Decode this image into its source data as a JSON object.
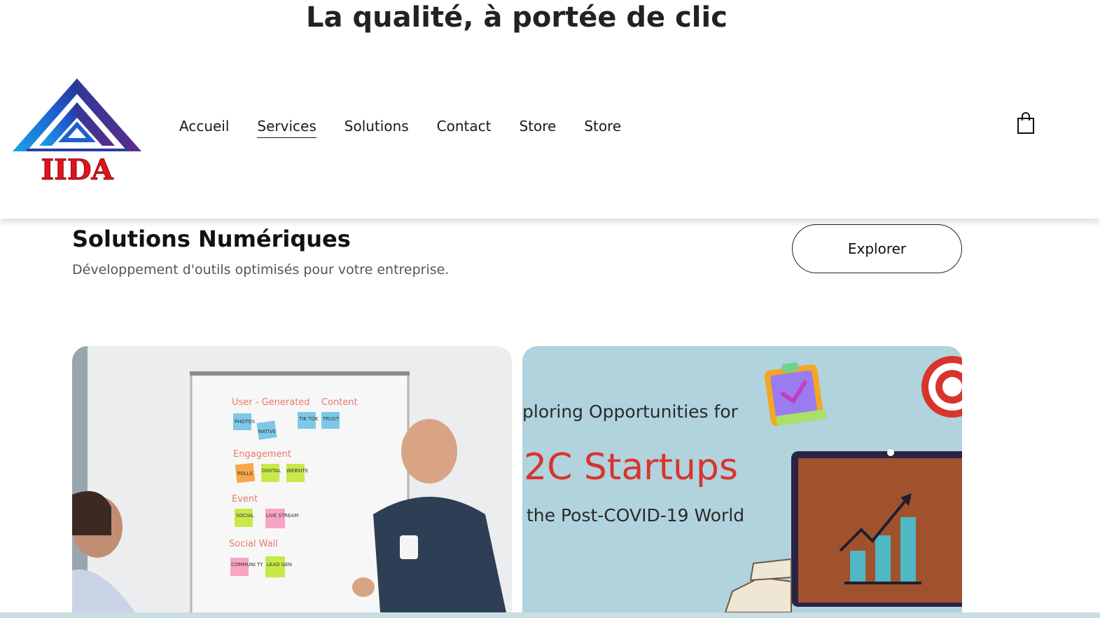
{
  "tagline": "La qualité, à portée de clic",
  "logo": {
    "text": "IIDA"
  },
  "nav": {
    "items": [
      {
        "label": "Accueil"
      },
      {
        "label": "Services",
        "active": true
      },
      {
        "label": "Solutions"
      },
      {
        "label": "Contact"
      },
      {
        "label": "Store"
      },
      {
        "label": "Store"
      }
    ]
  },
  "cart": {
    "icon": "shopping-bag-icon"
  },
  "intro": {
    "title": "Solutions Numériques",
    "subtitle": "Développement d'outils optimisés pour votre entreprise."
  },
  "explore_button": {
    "label": "Explorer"
  },
  "cards": {
    "left": {
      "whiteboard": {
        "headings": [
          "User - Generated",
          "Content",
          "Engagement",
          "Event",
          "Social Wall"
        ],
        "notes": [
          "PHOTOS",
          "NATIVE",
          "TIK TOK",
          "TRUST",
          "POLLS",
          "DIGITAL",
          "WEBSITE",
          "SOCIAL",
          "LIVE STREAM",
          "COMMUNI TY",
          "LEAD GEN"
        ]
      }
    },
    "right": {
      "line1": "ploring Opportunities for",
      "line2": "2C Startups",
      "line3": "the Post-COVID-19 World"
    }
  },
  "colors": {
    "logo_blue": "#1e6fd9",
    "logo_red": "#e3101e",
    "card_right_bg": "#b0d3de",
    "startups_red": "#d9342b",
    "monitor_brown": "#a0522d",
    "bar_teal": "#4fb8c4"
  }
}
